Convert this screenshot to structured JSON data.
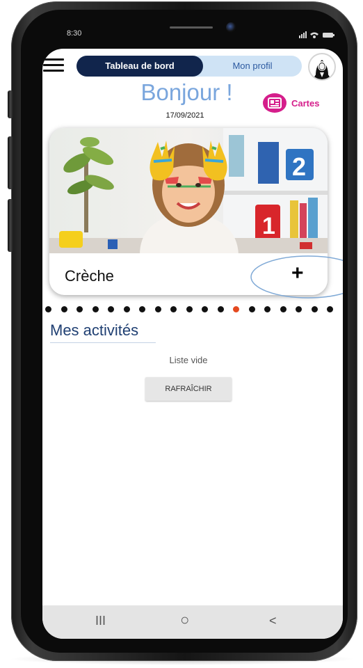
{
  "status_bar": {
    "time": "8:30"
  },
  "header": {
    "menu_icon": "hamburger-menu-icon",
    "tabs": [
      {
        "label": "Tableau de bord",
        "active": true
      },
      {
        "label": "Mon profil",
        "active": false
      }
    ],
    "avatar_icon": "user-avatar-icon"
  },
  "greeting": {
    "title": "Bonjour !",
    "date": "17/09/2021"
  },
  "cartes_button": {
    "label": "Cartes",
    "icon": "id-card-icon",
    "color": "#d51e8b"
  },
  "carousel": {
    "card": {
      "title": "Crèche",
      "add_label": "+"
    },
    "page_count": 19,
    "active_page": 12,
    "active_color": "#e4491f"
  },
  "activities": {
    "title": "Mes activités",
    "empty_text": "Liste vide",
    "refresh_label": "RAFRAÎCHIR"
  },
  "nav_bar": {
    "recents_label": "III",
    "home_label": "○",
    "back_label": "<"
  },
  "colors": {
    "primary_dark": "#11254c",
    "tab_light": "#cfe3f5",
    "greeting": "#7aa6dd",
    "section_title": "#1f3f72"
  }
}
